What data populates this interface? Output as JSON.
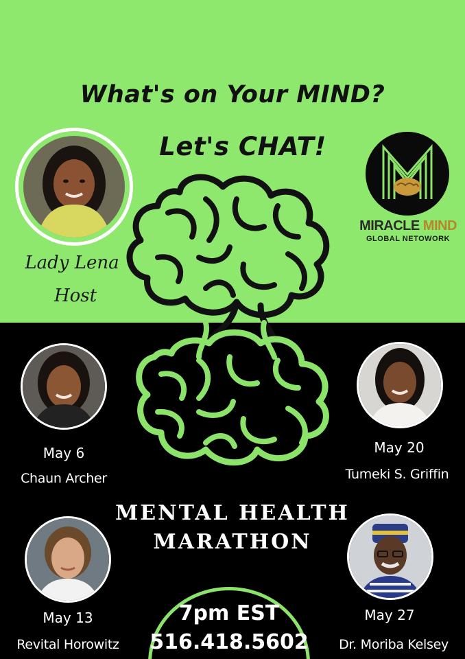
{
  "headline": {
    "line1": "What's on Your MIND?",
    "line2": "Let's CHAT!"
  },
  "host": {
    "name": "Lady Lena",
    "role": "Host"
  },
  "logo": {
    "word_a": "MIRACLE",
    "word_b": "MIND",
    "subtitle": "GLOBAL NETOWORK"
  },
  "event": {
    "title_line1": "MENTAL HEALTH",
    "title_line2": "MARATHON",
    "time": "7pm EST",
    "phone": "516.418.5602"
  },
  "guests": [
    {
      "date": "May 6",
      "name": "Chaun Archer"
    },
    {
      "date": "May 20",
      "name": "Tumeki S. Griffin"
    },
    {
      "date": "May 13",
      "name": "Revital Horowitz"
    },
    {
      "date": "May 27",
      "name": "Dr. Moriba Kelsey"
    }
  ],
  "colors": {
    "green": "#8ee86e",
    "black": "#000000",
    "accent_gold": "#b8862a"
  }
}
